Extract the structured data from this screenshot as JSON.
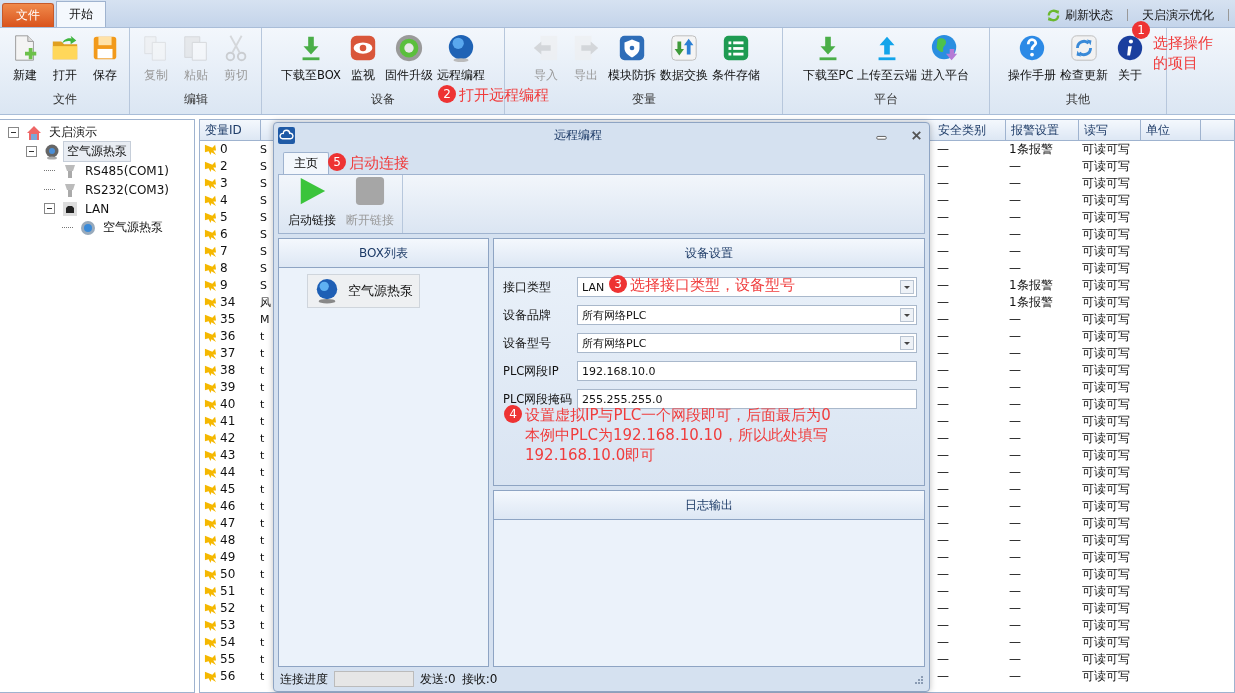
{
  "menu_tabs": [
    {
      "label": "文件",
      "kind": "menu",
      "selected": false
    },
    {
      "label": "开始",
      "kind": "tab",
      "selected": true
    }
  ],
  "quick_actions": [
    {
      "label": "刷新状态",
      "kind": "refresh"
    },
    {
      "label": "天启演示优化",
      "kind": "plain"
    }
  ],
  "ribbon": {
    "groups": [
      {
        "label": "文件",
        "buttons": [
          {
            "label": "新建",
            "disabled": false
          },
          {
            "label": "打开",
            "disabled": false
          },
          {
            "label": "保存",
            "disabled": false
          }
        ]
      },
      {
        "label": "编辑",
        "buttons": [
          {
            "label": "复制",
            "disabled": true
          },
          {
            "label": "粘贴",
            "disabled": true
          },
          {
            "label": "剪切",
            "disabled": true
          }
        ]
      },
      {
        "label": "设备",
        "buttons": [
          {
            "label": "下载至BOX",
            "disabled": false
          },
          {
            "label": "监视",
            "disabled": false
          },
          {
            "label": "固件升级",
            "disabled": false
          },
          {
            "label": "远程编程",
            "disabled": false
          }
        ]
      },
      {
        "label": "变量",
        "buttons": [
          {
            "label": "导入",
            "disabled": true
          },
          {
            "label": "导出",
            "disabled": true
          },
          {
            "label": "模块防拆",
            "disabled": false
          },
          {
            "label": "数据交换",
            "disabled": false
          },
          {
            "label": "条件存储",
            "disabled": false
          }
        ]
      },
      {
        "label": "平台",
        "buttons": [
          {
            "label": "下载至PC",
            "disabled": false
          },
          {
            "label": "上传至云端",
            "disabled": false
          },
          {
            "label": "进入平台",
            "disabled": false
          }
        ]
      },
      {
        "label": "其他",
        "buttons": [
          {
            "label": "操作手册",
            "disabled": false
          },
          {
            "label": "检查更新",
            "disabled": false
          },
          {
            "label": "关于",
            "disabled": false
          }
        ]
      }
    ]
  },
  "tree": [
    {
      "label": "天启演示",
      "selected": false,
      "expanded": true,
      "children": [
        {
          "label": "空气源热泵",
          "selected": true,
          "expanded": true,
          "children": [
            {
              "label": "RS485(COM1)",
              "selected": false
            },
            {
              "label": "RS232(COM3)",
              "selected": false
            },
            {
              "label": "LAN",
              "selected": false,
              "expanded": true,
              "children": [
                {
                  "label": "空气源热泵",
                  "selected": false
                }
              ]
            }
          ]
        }
      ]
    }
  ],
  "table": {
    "columns": [
      "变量ID",
      "安全类别",
      "报警设置",
      "读写",
      "单位"
    ],
    "rows": [
      {
        "id": "0",
        "column_2": "S",
        "safety": "—",
        "alarm": "1条报警",
        "access": "可读可写"
      },
      {
        "id": "2",
        "column_2": "S",
        "safety": "—",
        "alarm": "—",
        "access": "可读可写"
      },
      {
        "id": "3",
        "column_2": "S",
        "safety": "—",
        "alarm": "—",
        "access": "可读可写"
      },
      {
        "id": "4",
        "column_2": "S",
        "safety": "—",
        "alarm": "—",
        "access": "可读可写"
      },
      {
        "id": "5",
        "column_2": "S",
        "safety": "—",
        "alarm": "—",
        "access": "可读可写"
      },
      {
        "id": "6",
        "column_2": "S",
        "safety": "—",
        "alarm": "—",
        "access": "可读可写"
      },
      {
        "id": "7",
        "column_2": "S",
        "safety": "—",
        "alarm": "—",
        "access": "可读可写"
      },
      {
        "id": "8",
        "column_2": "S",
        "safety": "—",
        "alarm": "—",
        "access": "可读可写"
      },
      {
        "id": "9",
        "column_2": "S",
        "safety": "—",
        "alarm": "1条报警",
        "access": "可读可写"
      },
      {
        "id": "34",
        "column_2": "风",
        "safety": "—",
        "alarm": "1条报警",
        "access": "可读可写"
      },
      {
        "id": "35",
        "column_2": "M",
        "safety": "—",
        "alarm": "—",
        "access": "可读可写"
      },
      {
        "id": "36",
        "column_2": "t",
        "safety": "—",
        "alarm": "—",
        "access": "可读可写"
      },
      {
        "id": "37",
        "column_2": "t",
        "safety": "—",
        "alarm": "—",
        "access": "可读可写"
      },
      {
        "id": "38",
        "column_2": "t",
        "safety": "—",
        "alarm": "—",
        "access": "可读可写"
      },
      {
        "id": "39",
        "column_2": "t",
        "safety": "—",
        "alarm": "—",
        "access": "可读可写"
      },
      {
        "id": "40",
        "column_2": "t",
        "safety": "—",
        "alarm": "—",
        "access": "可读可写"
      },
      {
        "id": "41",
        "column_2": "t",
        "safety": "—",
        "alarm": "—",
        "access": "可读可写"
      },
      {
        "id": "42",
        "column_2": "t",
        "safety": "—",
        "alarm": "—",
        "access": "可读可写"
      },
      {
        "id": "43",
        "column_2": "t",
        "safety": "—",
        "alarm": "—",
        "access": "可读可写"
      },
      {
        "id": "44",
        "column_2": "t",
        "safety": "—",
        "alarm": "—",
        "access": "可读可写"
      },
      {
        "id": "45",
        "column_2": "t",
        "safety": "—",
        "alarm": "—",
        "access": "可读可写"
      },
      {
        "id": "46",
        "column_2": "t",
        "safety": "—",
        "alarm": "—",
        "access": "可读可写"
      },
      {
        "id": "47",
        "column_2": "t",
        "safety": "—",
        "alarm": "—",
        "access": "可读可写"
      },
      {
        "id": "48",
        "column_2": "t",
        "safety": "—",
        "alarm": "—",
        "access": "可读可写"
      },
      {
        "id": "49",
        "column_2": "t",
        "safety": "—",
        "alarm": "—",
        "access": "可读可写"
      },
      {
        "id": "50",
        "column_2": "t",
        "safety": "—",
        "alarm": "—",
        "access": "可读可写"
      },
      {
        "id": "51",
        "column_2": "t",
        "safety": "—",
        "alarm": "—",
        "access": "可读可写"
      },
      {
        "id": "52",
        "column_2": "t",
        "safety": "—",
        "alarm": "—",
        "access": "可读可写"
      },
      {
        "id": "53",
        "column_2": "t",
        "safety": "—",
        "alarm": "—",
        "access": "可读可写"
      },
      {
        "id": "54",
        "column_2": "t",
        "safety": "—",
        "alarm": "—",
        "access": "可读可写"
      },
      {
        "id": "55",
        "column_2": "t",
        "safety": "—",
        "alarm": "—",
        "access": "可读可写"
      },
      {
        "id": "56",
        "column_2": "t",
        "safety": "—",
        "alarm": "—",
        "access": "可读可写"
      }
    ]
  },
  "dialog": {
    "title": "远程编程",
    "tabs": [
      {
        "label": "主页",
        "selected": true
      }
    ],
    "toolbar": [
      {
        "label": "启动链接",
        "kind": "start",
        "disabled": false
      },
      {
        "label": "断开链接",
        "kind": "stop",
        "disabled": true
      }
    ],
    "box_list": {
      "title": "BOX列表",
      "items": [
        {
          "label": "空气源热泵",
          "selected": false
        }
      ]
    },
    "device_settings": {
      "title": "设备设置",
      "fields": [
        {
          "label": "接口类型",
          "kind": "select",
          "value": "LAN"
        },
        {
          "label": "设备品牌",
          "kind": "select",
          "value": "所有网络PLC"
        },
        {
          "label": "设备型号",
          "kind": "select",
          "value": "所有网络PLC"
        },
        {
          "label": "PLC网段IP",
          "kind": "text",
          "value": "192.168.10.0"
        },
        {
          "label": "PLC网段掩码",
          "kind": "text",
          "value": "255.255.255.0"
        }
      ]
    },
    "log": {
      "title": "日志输出"
    },
    "status": {
      "label": "连接进度",
      "level": 0,
      "sent": "发送:0",
      "received": "接收:0"
    }
  },
  "annotations": [
    {
      "number": "1",
      "lines": [
        "选择操作",
        "的项目"
      ]
    },
    {
      "number": "2",
      "lines": [
        "打开远程编程"
      ]
    },
    {
      "number": "3",
      "lines": [
        "选择接口类型，设备型号"
      ]
    },
    {
      "number": "4",
      "lines": [
        "设置虚拟IP与PLC一个网段即可，后面最后为0",
        "本例中PLC为192.168.10.10，所以此处填写",
        "192.168.10.0即可"
      ]
    },
    {
      "number": "5",
      "lines": [
        "启动连接"
      ]
    }
  ]
}
